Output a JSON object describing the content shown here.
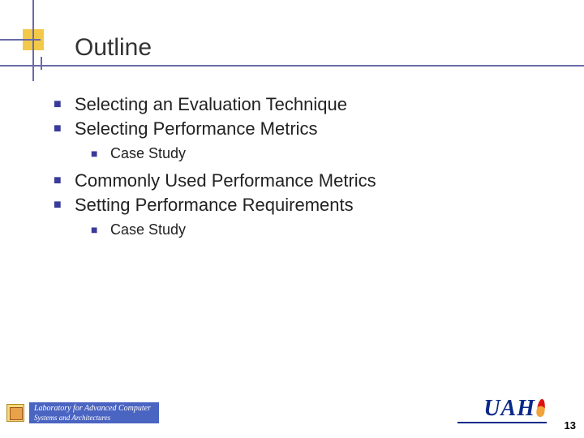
{
  "title": "Outline",
  "bullets": {
    "b1": "Selecting an Evaluation Technique",
    "b2": "Selecting Performance Metrics",
    "b2_sub": "Case Study",
    "b3": "Commonly Used Performance Metrics",
    "b4": "Setting Performance Requirements",
    "b4_sub": "Case Study"
  },
  "footer": {
    "lab_line1": "Laboratory for Advanced Computer",
    "lab_line2": "Systems and Architectures",
    "org": "UAH"
  },
  "page_number": "13"
}
